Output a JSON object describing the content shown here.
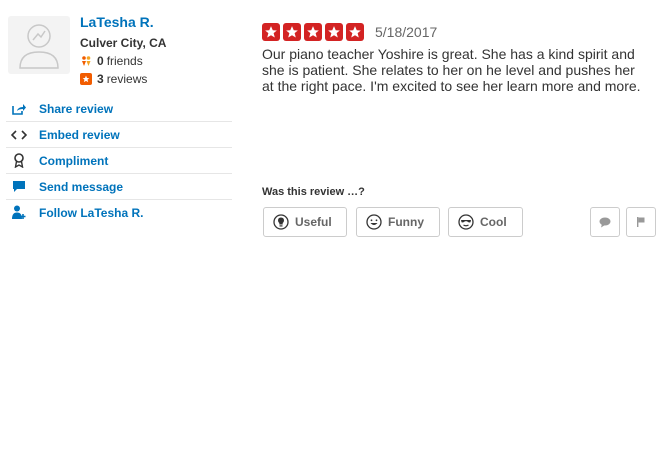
{
  "user": {
    "name": "LaTesha R.",
    "location": "Culver City, CA",
    "friends_count": "0",
    "friends_label": "friends",
    "reviews_count": "3",
    "reviews_label": "reviews"
  },
  "actions": [
    {
      "label": "Share review",
      "icon": "share-icon"
    },
    {
      "label": "Embed review",
      "icon": "embed-icon"
    },
    {
      "label": "Compliment",
      "icon": "compliment-icon"
    },
    {
      "label": "Send message",
      "icon": "message-icon"
    },
    {
      "label": "Follow LaTesha R.",
      "icon": "follow-icon"
    }
  ],
  "review": {
    "rating": 5,
    "rating_max": 5,
    "date": "5/18/2017",
    "text": "Our piano teacher Yoshire is great. She has a kind spirit and she is patient. She relates to her on he level and pushes her at the right pace. I'm excited to see her learn more and more."
  },
  "feedback": {
    "prompt": "Was this review …?",
    "useful_label": "Useful",
    "funny_label": "Funny",
    "cool_label": "Cool"
  },
  "colors": {
    "link": "#0073bb",
    "star": "#d32323",
    "badge": "#f15c00",
    "border": "#cccccc"
  }
}
